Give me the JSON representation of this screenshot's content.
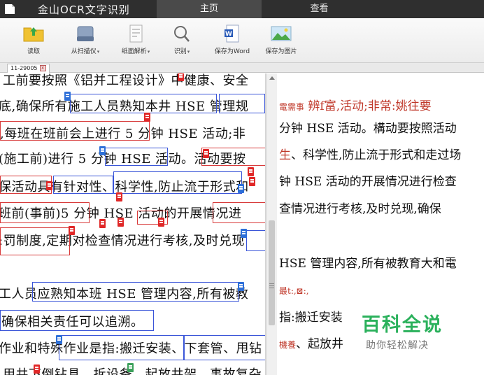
{
  "app": {
    "title": "金山OCR文字识别",
    "menu_tabs": [
      "主页",
      "查看"
    ]
  },
  "toolbar": {
    "items": [
      {
        "label": "读取",
        "icon": "folder-open-icon",
        "dropdown": false
      },
      {
        "label": "从扫描仪",
        "icon": "scanner-icon",
        "dropdown": true
      },
      {
        "label": "纸面解析",
        "icon": "page-analyze-icon",
        "dropdown": true
      },
      {
        "label": "识别",
        "icon": "magnifier-icon",
        "dropdown": true
      },
      {
        "label": "保存为Word",
        "icon": "word-doc-icon",
        "dropdown": false
      },
      {
        "label": "保存为图片",
        "icon": "image-icon",
        "dropdown": false
      }
    ],
    "caret": "▾"
  },
  "document_tab": {
    "label": "11-29005",
    "close": "x"
  },
  "left_doc": {
    "lines": [
      "工前要按照《铝并工程设计》中健康、安全",
      "底,确保所有施工人员熟知本井 HSE 管理规",
      ",每班在班前会上进行 5 分钟 HSE 活动;非",
      "(施工前)进行 5 分钟 HSE 活动。活动要按",
      "保活动具有针对性、科学性,防止流于形式和",
      "班前(事前)5 分钟 HSE 活动的开展情况进",
      ":罚制度,定期对检查情况进行考核,及时兑现",
      "工人员应熟知本班 HSE 管理内容,所有被教",
      "确保相关责任可以追溯。",
      "作业和特殊作业是指:搬迁安装、下套管、甩钻",
      "用井下倒钻具、拆设备、起放井架、事故复杂"
    ]
  },
  "right_text": {
    "lines": [
      {
        "pre": "",
        "red": "電需事",
        "rest": "  辨f富,活动;非常:姚往要"
      },
      {
        "pre": "分钟 HSE 活动。構动要按照活动",
        "red": "",
        "rest": ""
      },
      {
        "pre": "",
        "red": "生",
        "rest": "、科学性,防止流于形式和走过场"
      },
      {
        "pre": "钟 HSE 活动的开展情况进行检查",
        "red": "",
        "rest": ""
      },
      {
        "pre": "查情况进行考核,及时兑现,确保",
        "red": "",
        "rest": ""
      },
      {
        "pre": "HSE 管理内容,所有被教育大和電",
        "red": "",
        "rest": ""
      },
      {
        "pre": "",
        "red": "最t:,⊠:,",
        "rest": ""
      },
      {
        "pre": "指:搬迁安装",
        "red": "",
        "rest": ""
      },
      {
        "pre": "",
        "red": "機養",
        "rest": "、起放井"
      }
    ]
  },
  "watermark": {
    "title": "百科全说",
    "subtitle": "助你轻松解决"
  }
}
